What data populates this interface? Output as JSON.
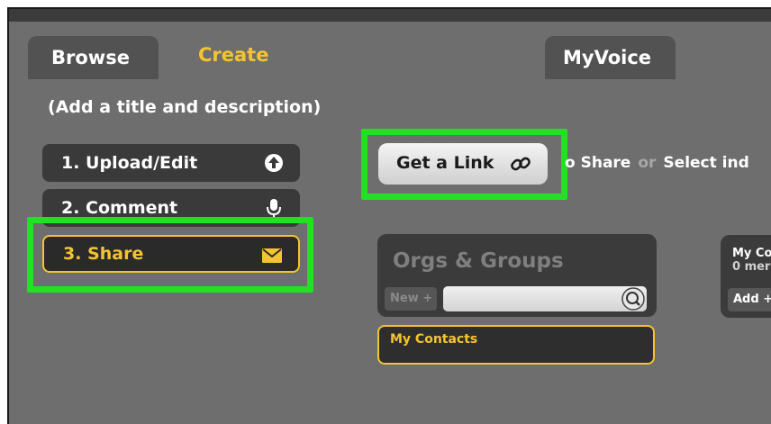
{
  "tabs": {
    "browse": "Browse",
    "create": "Create",
    "myvoice": "MyVoice"
  },
  "hint": "(Add a title and description)",
  "steps": [
    {
      "label": "1. Upload/Edit",
      "icon": "upload-arrow-icon"
    },
    {
      "label": "2. Comment",
      "icon": "microphone-icon"
    },
    {
      "label": "3. Share",
      "icon": "envelope-icon"
    }
  ],
  "share": {
    "get_link": "Get a Link",
    "to_share_text": "o Share",
    "or": "or",
    "select_text": "Select ind"
  },
  "orgs": {
    "title": "Orgs & Groups",
    "new_button": "New +",
    "search_placeholder": ""
  },
  "contacts": {
    "label": "My Contacts"
  },
  "contacts_panel": {
    "title": "My Co",
    "members": "0 mer",
    "add": "Add +"
  },
  "colors": {
    "accent": "#f4c430",
    "highlight": "#22e022",
    "background": "#6e6e6e"
  }
}
